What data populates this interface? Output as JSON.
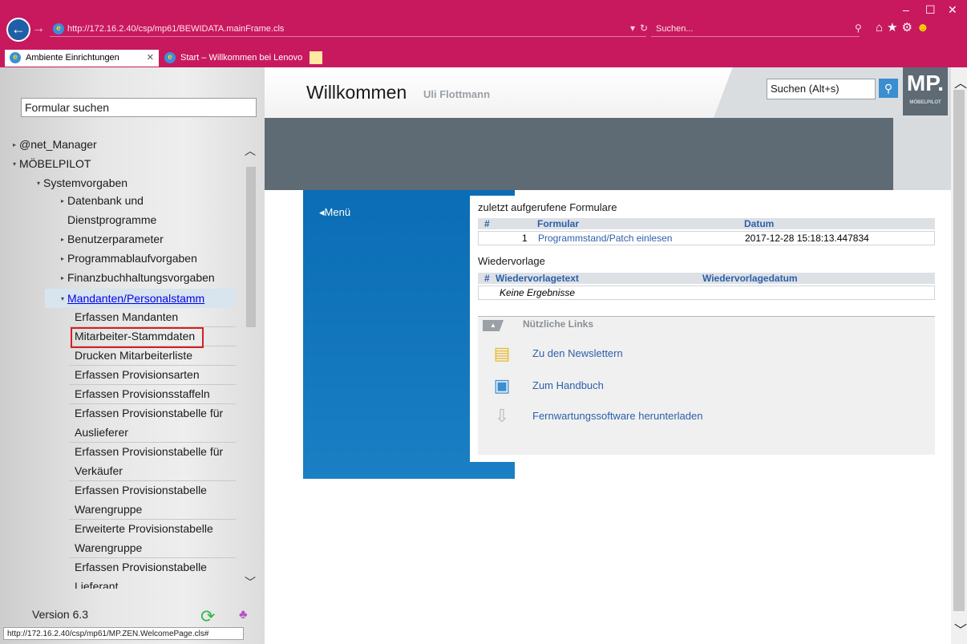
{
  "browser": {
    "url": "http://172.16.2.40/csp/mp61/BEWIDATA.mainFrame.cls",
    "search_placeholder": "Suchen...",
    "tabs": [
      {
        "label": "Ambiente Einrichtungen"
      },
      {
        "label": "Start – Willkommen bei Lenovo"
      }
    ],
    "status_url": "http://172.16.2.40/csp/mp61/MP.ZEN.WelcomePage.cls#"
  },
  "sidebar": {
    "search_value": "Formular suchen",
    "version": "Version 6.3",
    "tree": {
      "net_manager": "@net_Manager",
      "moebelpilot": "MÖBELPILOT",
      "systemvorgaben": "Systemvorgaben",
      "datenbank_1": "Datenbank und",
      "datenbank_2": "Dienstprogramme",
      "benutzerparameter": "Benutzerparameter",
      "programmablauf": "Programmablaufvorgaben",
      "finanzbuchhaltung": "Finanzbuchhaltungsvorgaben",
      "mandanten": "Mandanten/Personalstamm"
    },
    "leaves": [
      "Erfassen Mandanten",
      "Mitarbeiter-Stammdaten",
      "Drucken Mitarbeiterliste",
      "Erfassen Provisionsarten",
      "Erfassen Provisionsstaffeln",
      "Erfassen Provisionstabelle für",
      "Auslieferer",
      "Erfassen Provisionstabelle für",
      "Verkäufer",
      "Erfassen Provisionstabelle",
      "Warengruppe",
      "Erweiterte Provisionstabelle",
      "Warengruppe",
      "Erfassen Provisionstabelle",
      "Lieferant"
    ]
  },
  "main": {
    "welcome": "Willkommen",
    "user": "Uli Flottmann",
    "search_value": "Suchen (Alt+s)",
    "logo_text": "MP.",
    "logo_sub": "MÖBELPILOT",
    "menu_label": "Menü",
    "recent": {
      "title": "zuletzt aufgerufene Formulare",
      "headers": [
        "#",
        "Formular",
        "Datum"
      ],
      "rows": [
        {
          "num": "1",
          "form": "Programmstand/Patch einlesen",
          "date": "2017-12-28 15:18:13.447834"
        }
      ]
    },
    "resubmission": {
      "title": "Wiedervorlage",
      "headers": [
        "#",
        "Wiedervorlagetext",
        "Wiedervorlagedatum"
      ],
      "empty": "Keine Ergebnisse"
    },
    "useful_links": {
      "title": "Nützliche Links",
      "items": [
        {
          "label": "Zu den Newslettern",
          "icon": "newsletter-icon"
        },
        {
          "label": "Zum Handbuch",
          "icon": "handbook-icon"
        },
        {
          "label": "Fernwartungssoftware herunterladen",
          "icon": "download-icon"
        }
      ]
    }
  },
  "colors": {
    "browser_chrome": "#c8195e",
    "menu_blue": "#0a6db5",
    "banner_gray": "#5e6a74",
    "link_blue": "#2c5faa",
    "highlight_red": "#d62020"
  }
}
